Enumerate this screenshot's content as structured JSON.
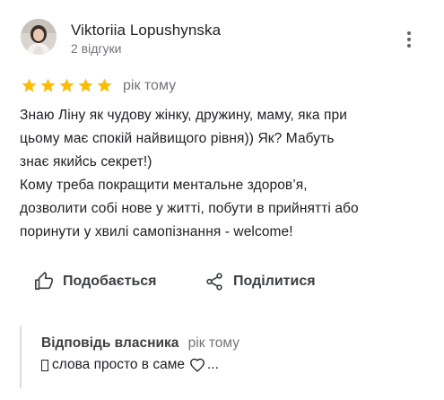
{
  "review": {
    "author_name": "Viktoriia Lopushynska",
    "author_meta": "2 відгуки",
    "rating": 5,
    "time": "рік тому",
    "text": "Знаю Ліну як чудову жінку, дружину, маму, яка при\nцьому має спокій найвищого рівня)) Як? Мабуть\nзнає якийсь секрет!)\nКому треба покращити ментальне здоров’я,\nдозволити собі нове у житті, побути в прийнятті або\nпоринути у хвилі самопізнання - welcome!"
  },
  "actions": {
    "like_label": "Подобається",
    "share_label": "Поділитися"
  },
  "owner_response": {
    "title": "Відповідь власника",
    "time": "рік тому",
    "text_before": "слова просто в саме",
    "text_after": "..."
  },
  "icons": {
    "more": "more-vert-icon",
    "star": "star-icon",
    "like": "thumb-up-icon",
    "share": "share-icon",
    "heart": "heart-icon"
  },
  "colors": {
    "star": "#fbbc04",
    "text": "#202124",
    "muted": "#70757a",
    "divider": "#dadce0"
  }
}
